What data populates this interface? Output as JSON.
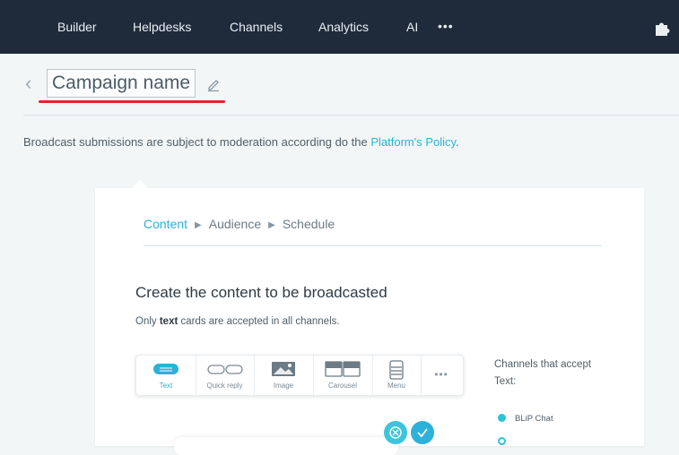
{
  "nav": {
    "items": [
      {
        "label": "Builder"
      },
      {
        "label": "Helpdesks"
      },
      {
        "label": "Channels"
      },
      {
        "label": "Analytics"
      },
      {
        "label": "AI"
      }
    ],
    "more": "•••"
  },
  "header": {
    "title": "Campaign name"
  },
  "notice": {
    "text": "Broadcast submissions are subject to moderation according do the ",
    "link": "Platform's Policy",
    "suffix": "."
  },
  "card": {
    "steps": [
      "Content",
      "Audience",
      "Schedule"
    ],
    "heading": "Create the content to be broadcasted",
    "subtext_prefix": "Only ",
    "subtext_bold": "text",
    "subtext_suffix": " cards are accepted in all channels.",
    "toolbar": {
      "items": [
        {
          "label": "Text",
          "icon": "text-card-icon"
        },
        {
          "label": "Quick reply",
          "icon": "quick-reply-icon"
        },
        {
          "label": "Image",
          "icon": "image-icon"
        },
        {
          "label": "Carousel",
          "icon": "carousel-icon"
        },
        {
          "label": "Menu",
          "icon": "menu-icon"
        }
      ],
      "more": "•••"
    },
    "channels_title": "Channels that accept Text:",
    "channels": [
      {
        "label": "BLiP Chat"
      }
    ]
  },
  "colors": {
    "nav_bg": "#1f2b3b",
    "accent": "#2cb1d9",
    "teal": "#2cc3d4",
    "underline": "#e0262c"
  }
}
